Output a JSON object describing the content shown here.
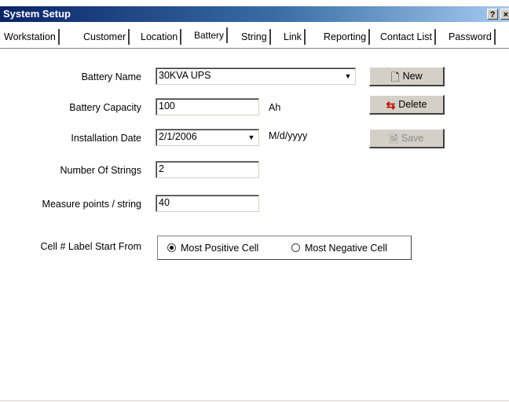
{
  "window": {
    "title": "System Setup",
    "help_label": "?",
    "close_label": "×"
  },
  "tabs": [
    {
      "label": "Workstation"
    },
    {
      "label": "Customer"
    },
    {
      "label": "Location"
    },
    {
      "label": "Battery",
      "active": true
    },
    {
      "label": "String"
    },
    {
      "label": "Link"
    },
    {
      "label": "Reporting"
    },
    {
      "label": "Contact List"
    },
    {
      "label": "Password"
    }
  ],
  "form": {
    "battery_name": {
      "label": "Battery Name",
      "value": "30KVA UPS"
    },
    "battery_capacity": {
      "label": "Battery Capacity",
      "value": "100",
      "unit": "Ah"
    },
    "installation_date": {
      "label": "Installation Date",
      "value": "2/1/2006",
      "format": "M/d/yyyy"
    },
    "number_of_strings": {
      "label": "Number Of Strings",
      "value": "2"
    },
    "measure_points": {
      "label": "Measure points / string",
      "value": "40"
    },
    "cell_label_start": {
      "label": "Cell # Label Start From",
      "options": [
        "Most Positive Cell",
        "Most Negative Cell"
      ],
      "selected": "Most Positive Cell"
    }
  },
  "buttons": {
    "new": {
      "label": "New",
      "icon": "new-document-icon"
    },
    "delete": {
      "label": "Delete",
      "icon": "delete-icon"
    },
    "save": {
      "label": "Save",
      "icon": "save-icon",
      "enabled": false
    }
  },
  "colors": {
    "titlebar_start": "#0a246a",
    "titlebar_end": "#a6caf0",
    "button_face": "#d4d0c8"
  }
}
